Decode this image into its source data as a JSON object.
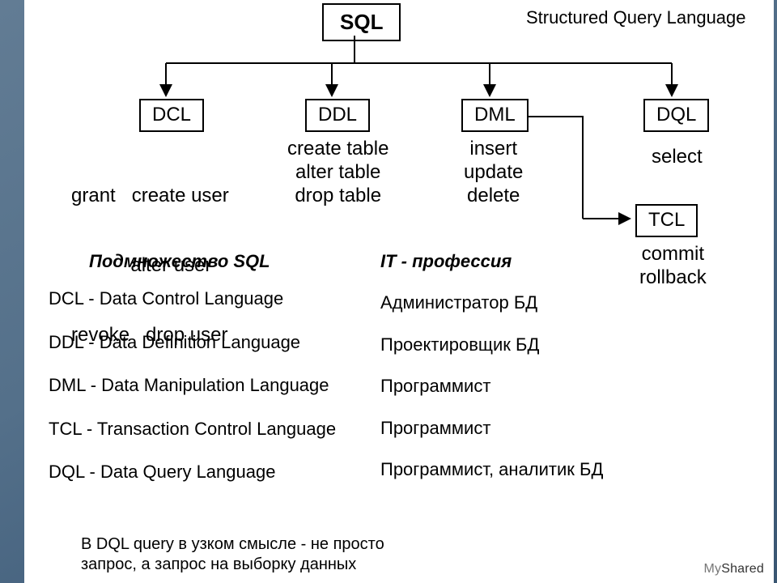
{
  "root": {
    "label": "SQL",
    "subtitle": "Structured Query Language"
  },
  "children": {
    "dcl": {
      "label": "DCL",
      "lines": [
        "grant   create user",
        "           alter user",
        "revoke   drop user"
      ]
    },
    "ddl": {
      "label": "DDL",
      "lines": [
        "create table",
        "alter table",
        "drop table"
      ]
    },
    "dml": {
      "label": "DML",
      "lines": [
        "insert",
        "update",
        "delete"
      ]
    },
    "dql": {
      "label": "DQL",
      "lines": [
        "select"
      ]
    },
    "tcl": {
      "label": "TCL",
      "lines": [
        "commit",
        "rollback"
      ]
    }
  },
  "subsetHeader": "Подмножество SQL",
  "subset": [
    "DCL - Data Control Language",
    "DDL - Data Definition Language",
    "DML - Data Manipulation Language",
    "TCL - Transaction Control Language",
    "DQL - Data Query Language"
  ],
  "jobsHeader": "IT - профессия",
  "jobs": [
    "Администратор БД",
    "Проектировщик БД",
    "Программист",
    "Программист",
    "Программист, аналитик БД"
  ],
  "footnote1": "В DQL query в узком смысле - не просто",
  "footnote2": "запрос, а запрос на выборку данных",
  "watermark": {
    "pre": "My",
    "bold": "Shared"
  }
}
